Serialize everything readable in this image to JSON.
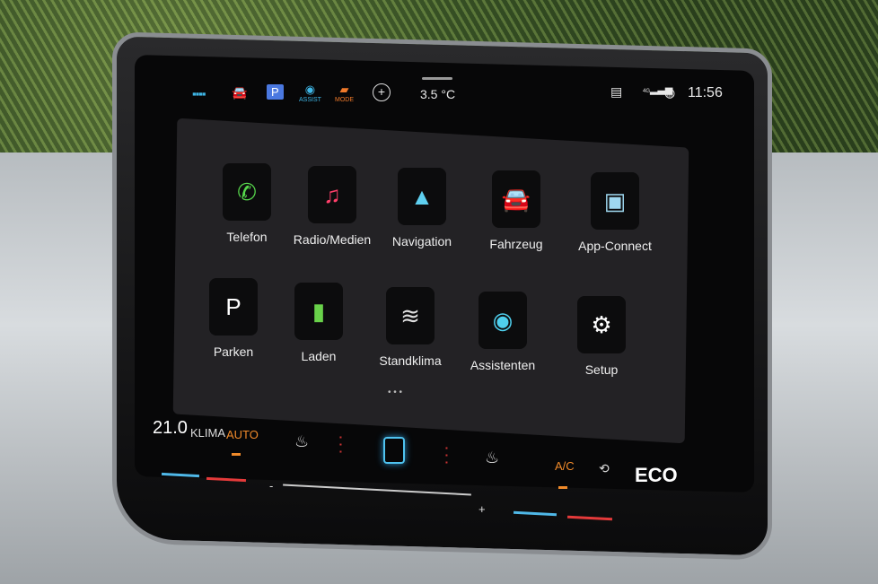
{
  "status_bar": {
    "icons": [
      "app-grid-icon",
      "car-icon",
      "parking-icon",
      "assist-icon",
      "mode-icon",
      "add-icon"
    ],
    "parking_label": "P",
    "assist_label": "ASSIST",
    "mode_label": "MODE",
    "temperature": "3.5 °C",
    "network": "4G",
    "time": "11:56",
    "colors": {
      "accent": "#3fb6e6",
      "mode": "#f07a2a"
    }
  },
  "apps": [
    {
      "label": "Telefon",
      "icon": "phone-icon",
      "glyph": "✆",
      "color": "#57d84c"
    },
    {
      "label": "Radio/Medien",
      "icon": "music-icon",
      "glyph": "♫",
      "color": "#ff3f6a"
    },
    {
      "label": "Navigation",
      "icon": "navigation-arrow-icon",
      "glyph": "▲",
      "color": "#5fd0f0"
    },
    {
      "label": "Fahrzeug",
      "icon": "car-icon",
      "glyph": "🚘",
      "color": "#ffffff"
    },
    {
      "label": "App-Connect",
      "icon": "app-connect-icon",
      "glyph": "▣",
      "color": "#9fd8f0"
    },
    {
      "label": "Parken",
      "icon": "parking-icon",
      "glyph": "P",
      "color": "#ffffff"
    },
    {
      "label": "Laden",
      "icon": "charging-icon",
      "glyph": "▮",
      "color": "#69d24a"
    },
    {
      "label": "Standklima",
      "icon": "climate-icon",
      "glyph": "≋",
      "color": "#e0e0e0"
    },
    {
      "label": "Assistenten",
      "icon": "assist-icon",
      "glyph": "◉",
      "color": "#4fd0ee"
    },
    {
      "label": "Setup",
      "icon": "gear-icon",
      "glyph": "⚙",
      "color": "#ffffff"
    }
  ],
  "page_dots": "• • •",
  "climate": {
    "temperature": "21.0",
    "klima": "KLIMA",
    "auto": "AUTO",
    "ac": "A/C",
    "eco": "ECO",
    "minus": "-",
    "plus": "+",
    "colors": {
      "active": "#f08a2a",
      "cold": "#4fb8e8",
      "hot": "#e43a3a"
    }
  }
}
